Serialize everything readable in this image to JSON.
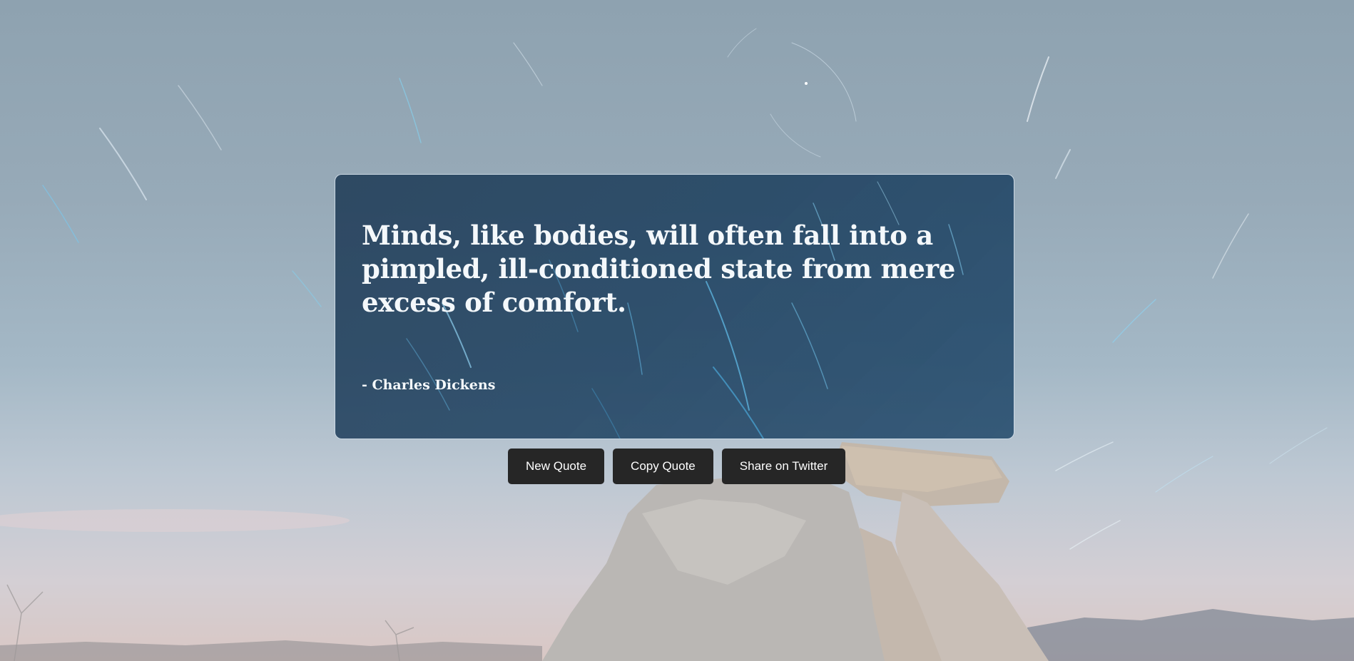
{
  "quote": {
    "text": "Minds, like bodies, will often fall into a pimpled, ill-conditioned state from mere excess of comfort.",
    "author": "- Charles Dickens"
  },
  "buttons": {
    "new_quote": "New Quote",
    "copy_quote": "Copy Quote",
    "share_twitter": "Share on Twitter"
  },
  "colors": {
    "button_bg": "#262626",
    "button_text": "#ffffff",
    "card_bg": "#183450",
    "text": "#f4f8fb"
  }
}
